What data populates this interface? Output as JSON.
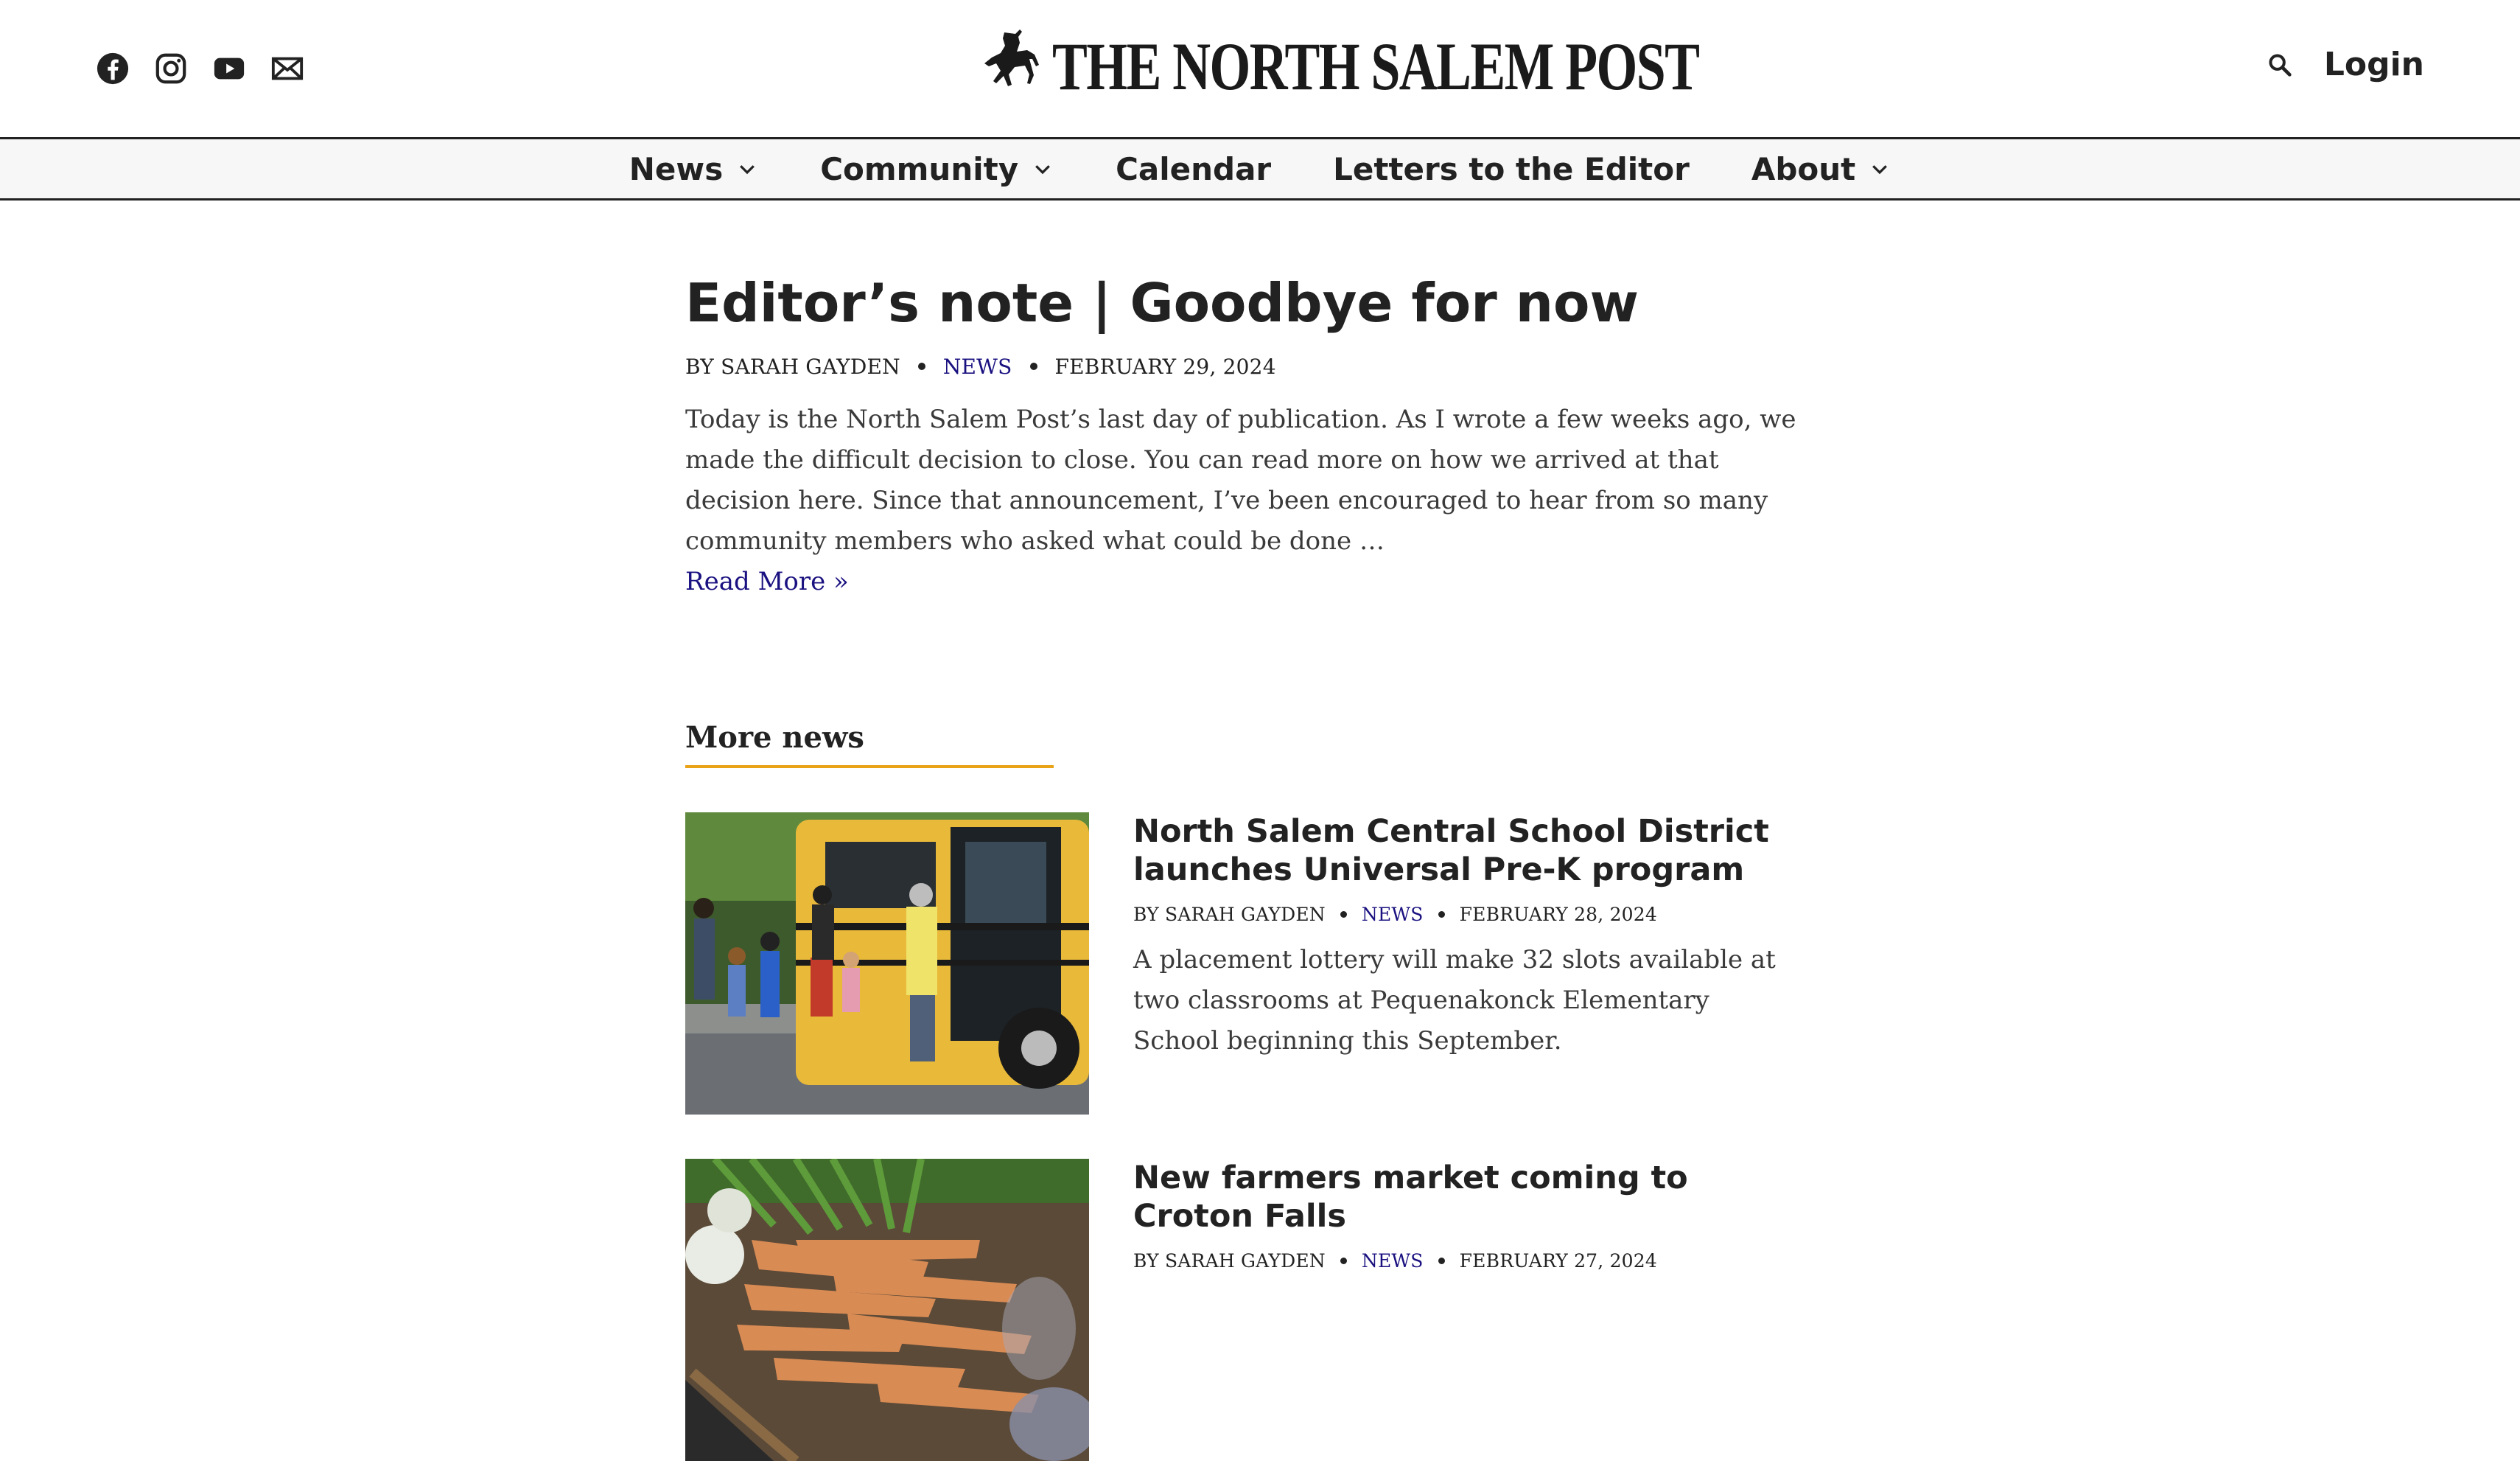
{
  "header": {
    "social_icons": [
      "facebook-icon",
      "instagram-icon",
      "youtube-icon",
      "email-icon"
    ],
    "site_title": "THE NORTH SALEM POST",
    "search_icon": "search-icon",
    "login_label": "Login"
  },
  "nav": {
    "items": [
      {
        "label": "News",
        "has_dropdown": true
      },
      {
        "label": "Community",
        "has_dropdown": true
      },
      {
        "label": "Calendar",
        "has_dropdown": false
      },
      {
        "label": "Letters to the Editor",
        "has_dropdown": false
      },
      {
        "label": "About",
        "has_dropdown": true
      }
    ]
  },
  "lead": {
    "title": "Editor’s note | Goodbye for now",
    "byline": "BY SARAH GAYDEN",
    "category": "NEWS",
    "date": "FEBRUARY 29, 2024",
    "excerpt": "Today is the North Salem Post’s last day of publication. As I wrote a few weeks ago, we made the difficult decision to close. You can read more on how we arrived at that decision here. Since that announcement, I’ve been encouraged to hear from so many community members who asked what could be done …",
    "read_more": "Read More »"
  },
  "more_news": {
    "heading": "More news",
    "stories": [
      {
        "title": "North Salem Central School District launches Universal Pre-K program",
        "byline": "BY SARAH GAYDEN",
        "category": "NEWS",
        "date": "FEBRUARY 28, 2024",
        "excerpt": "A placement lottery will make 32 slots available at two classrooms at Pequenakonck Elementary School beginning this September."
      },
      {
        "title": "New farmers market coming to Croton Falls",
        "byline": "BY SARAH GAYDEN",
        "category": "NEWS",
        "date": "FEBRUARY 27, 2024",
        "excerpt": ""
      }
    ]
  },
  "colors": {
    "link": "#1a1180",
    "accent_underline": "#e8a317",
    "text": "#222222"
  }
}
